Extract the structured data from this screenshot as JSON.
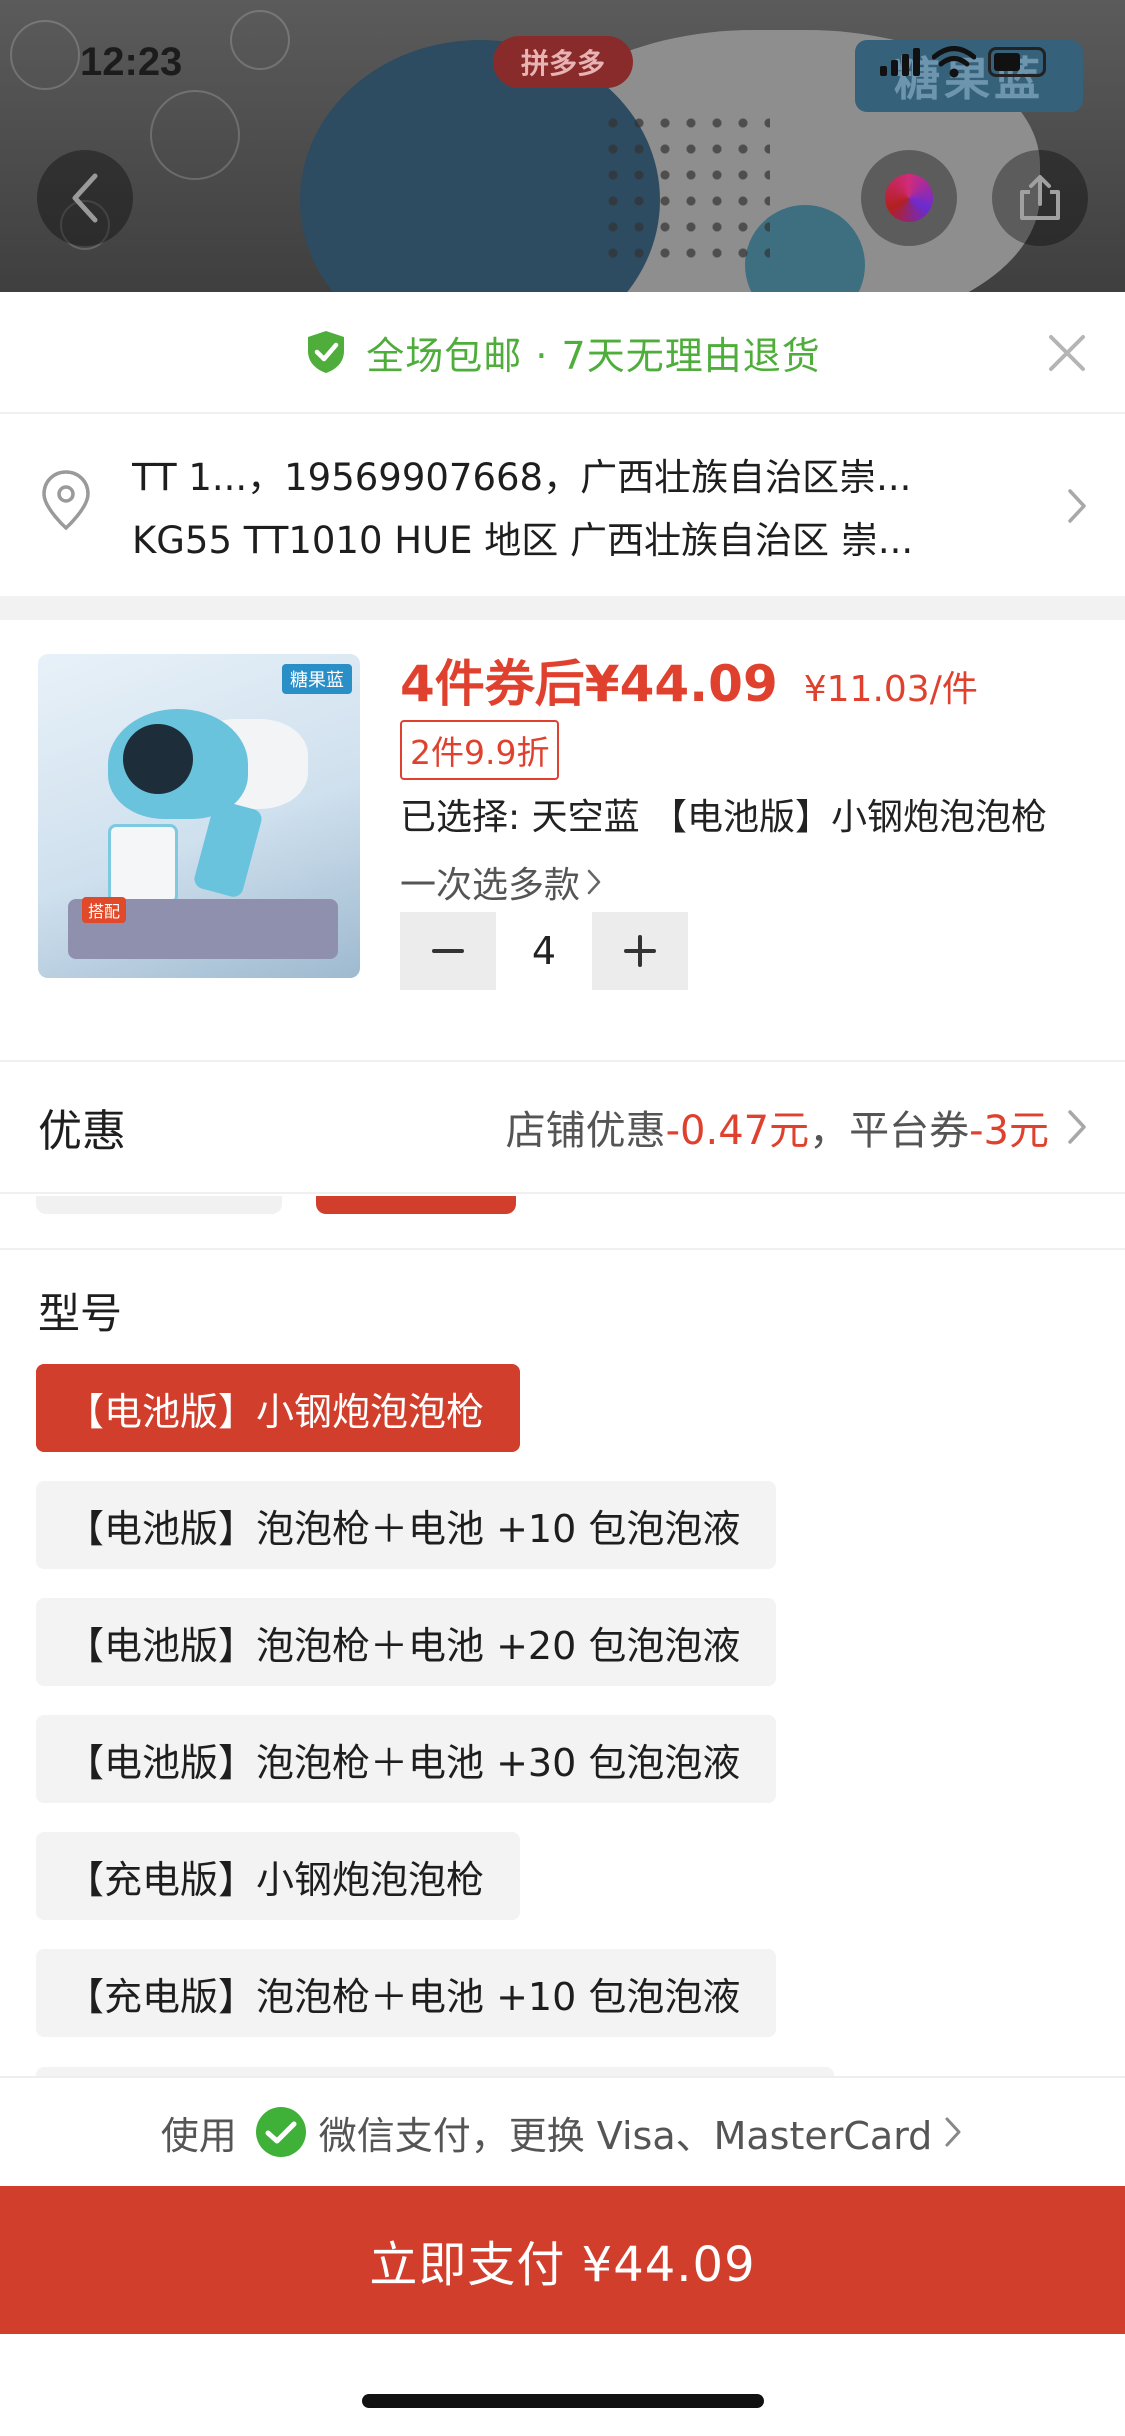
{
  "status_bar": {
    "time": "12:23",
    "battery": "4"
  },
  "header": {
    "platform_badge": "拼多多",
    "shop_badge": "糖果蓝"
  },
  "notice": {
    "text": "全场包邮 · 7天无理由退货"
  },
  "address": {
    "line1": "TT 1...，19569907668，广西壮族自治区崇...",
    "line2": "KG55 TT1010 HUE 地区 广西壮族自治区 崇..."
  },
  "product": {
    "thumb_label": "糖果蓝",
    "thumb_tag": "搭配",
    "price_main": "4件券后¥44.09",
    "price_unit": "¥11.03/件",
    "discount_tag": "2件9.9折",
    "selected": "已选择: 天空蓝 【电池版】小钢炮泡泡枪",
    "multi_select": "一次选多款",
    "quantity": "4"
  },
  "discount": {
    "title": "优惠",
    "shop_label": "店铺优惠",
    "shop_value": "-0.47元",
    "sep": "，",
    "platform_label": "平台券",
    "platform_value": "-3元"
  },
  "model": {
    "title": "型号",
    "options": [
      "【电池版】小钢炮泡泡枪",
      "【电池版】泡泡枪＋电池 +10 包泡泡液",
      "【电池版】泡泡枪＋电池 +20 包泡泡液",
      "【电池版】泡泡枪＋电池 +30 包泡泡液",
      "【充电版】小钢炮泡泡枪",
      "【充电版】泡泡枪＋电池 +10 包泡泡液"
    ],
    "selected_index": 0
  },
  "payment": {
    "use_label": "使用",
    "method_text": "微信支付，更换 Visa、MasterCard",
    "pay_button": "立即支付 ¥44.09"
  },
  "colors": {
    "accent_red": "#d23e2c",
    "price_red": "#e0412f",
    "notice_green": "#4fae3b",
    "wechat_green": "#3fb139"
  }
}
